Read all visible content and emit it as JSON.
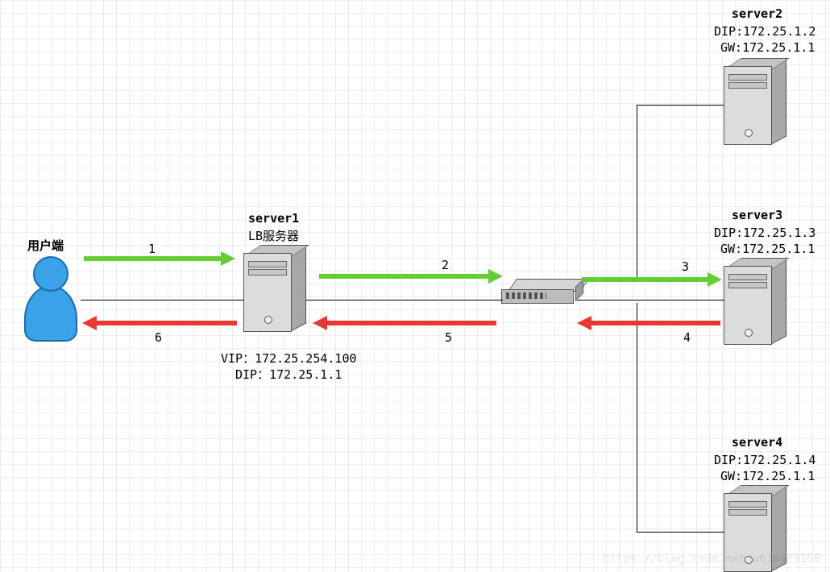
{
  "client": {
    "title": "用户端"
  },
  "lb": {
    "name": "server1",
    "role": "LB服务器",
    "vip_line": "VIP：172.25.254.100",
    "dip_line": "DIP：172.25.1.1"
  },
  "servers": [
    {
      "name": "server2",
      "dip_line": "DIP:172.25.1.2",
      "gw_line": "GW:172.25.1.1"
    },
    {
      "name": "server3",
      "dip_line": "DIP:172.25.1.3",
      "gw_line": "GW:172.25.1.1"
    },
    {
      "name": "server4",
      "dip_line": "DIP:172.25.1.4",
      "gw_line": "GW:172.25.1.1"
    }
  ],
  "flow_numbers": {
    "n1": "1",
    "n2": "2",
    "n3": "3",
    "n4": "4",
    "n5": "5",
    "n6": "6"
  },
  "watermark": "https://blog.csdn.net/u010489158",
  "colors": {
    "forward": "#66cc33",
    "reverse": "#e53935",
    "user": "#3aa2e8"
  }
}
